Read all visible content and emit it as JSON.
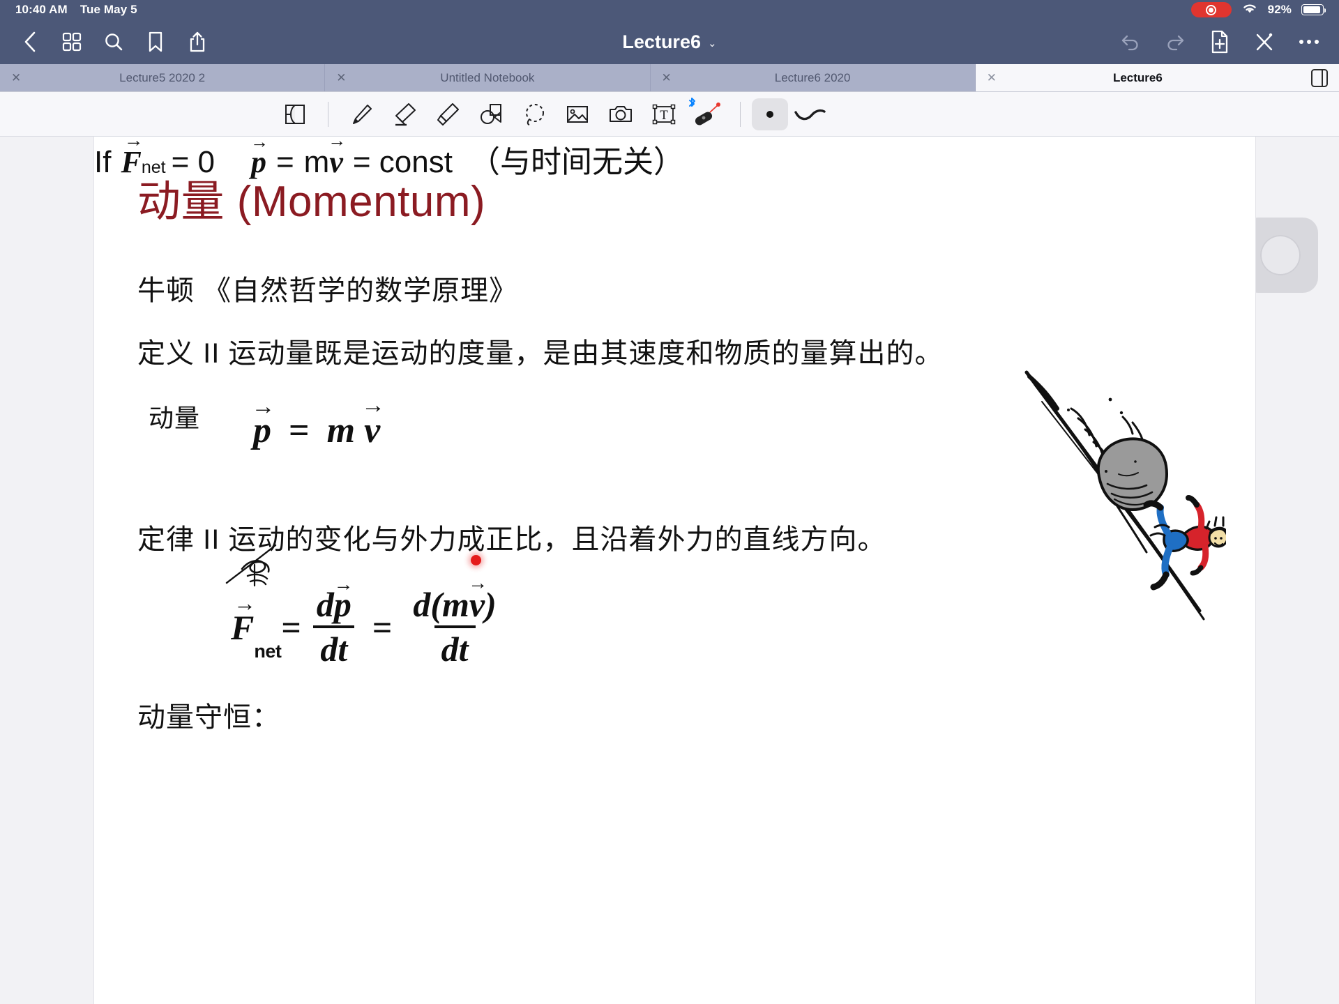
{
  "status_bar": {
    "time": "10:40 AM",
    "date": "Tue May 5",
    "battery_percent": "92%",
    "icons": [
      "screen-record-icon",
      "wifi-icon",
      "battery-icon"
    ]
  },
  "toolbar": {
    "title": "Lecture6",
    "title_chevron": "⌄",
    "left_icons": [
      "back-icon",
      "grid-icon",
      "search-icon",
      "bookmark-icon",
      "share-icon"
    ],
    "right_icons": [
      "undo-icon",
      "redo-icon",
      "add-page-icon",
      "close-tools-icon",
      "more-icon"
    ]
  },
  "tabs": {
    "close_glyph": "✕",
    "items": [
      {
        "label": "Lecture5 2020 2",
        "active": false
      },
      {
        "label": "Untitled Notebook",
        "active": false
      },
      {
        "label": "Lecture6 2020",
        "active": false
      },
      {
        "label": "Lecture6",
        "active": true
      }
    ],
    "sidebar_toggle": "sidebar-toggle-icon"
  },
  "tool_palette": {
    "tools": [
      {
        "name": "page-flip-icon",
        "selected": false
      },
      {
        "name": "pen-icon",
        "selected": false
      },
      {
        "name": "eraser-icon",
        "selected": false
      },
      {
        "name": "highlighter-icon",
        "selected": false
      },
      {
        "name": "shapes-icon",
        "selected": false
      },
      {
        "name": "lasso-icon",
        "selected": false
      },
      {
        "name": "image-icon",
        "selected": false
      },
      {
        "name": "camera-icon",
        "selected": false
      },
      {
        "name": "text-box-icon",
        "selected": false
      },
      {
        "name": "laser-pointer-icon",
        "selected": false
      },
      {
        "name": "pointer-dot-icon",
        "selected": true
      },
      {
        "name": "ink-stroke-icon",
        "selected": false
      }
    ],
    "bluetooth_badge": "bluetooth-icon"
  },
  "slide": {
    "title": "动量 (Momentum)",
    "title_color": "#8b1b22",
    "newton_book": "牛顿 《自然哲学的数学原理》",
    "definition2": "定义 II 运动量既是运动的度量，是由其速度和物质的量算出的。",
    "momentum_label": "动量",
    "formula_momentum": {
      "p": "p",
      "eq": "=",
      "m": "m",
      "v": "v",
      "arrow": "→"
    },
    "law2": "定律 II 运动的变化与外力成正比，且沿着外力的直线方向。",
    "formula_fnet": {
      "F": "F",
      "sub_net": "net",
      "eq1": "=",
      "num1": "dp",
      "den1": "dt",
      "eq2": "=",
      "num2": "d(mv)",
      "den2": "dt"
    },
    "conservation_label": "动量守恒：",
    "formula_conservation": {
      "if": "If",
      "F": "F",
      "sub_net": "net",
      "eq0": "= 0",
      "p": "p",
      "eq1": "=",
      "mv": "m",
      "v": "v",
      "eq2": "= const",
      "note": "（与时间无关）"
    },
    "annotation": "handwritten-scribble",
    "laser_pointer_dot_color": "#e51b1b",
    "cartoon": "boulder-chasing-person-illustration"
  }
}
